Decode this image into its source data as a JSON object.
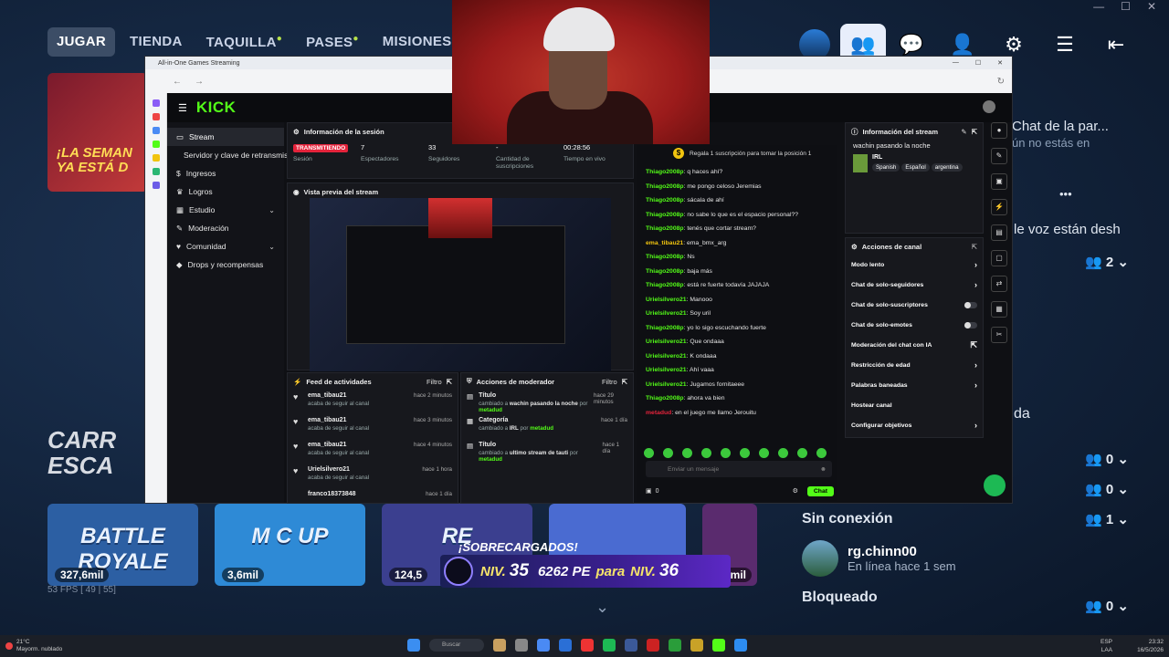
{
  "game": {
    "nav": [
      "JUGAR",
      "TIENDA",
      "TAQUILLA",
      "PASES",
      "MISIONES",
      "C"
    ],
    "promo_text": "¡LA SEMAN YA ESTÁ D",
    "carr_text": "CARR ESCA",
    "right_panel": {
      "party_title": "Chat de la par...",
      "party_sub": "ún no estás en",
      "voice_text": "le voz están desh",
      "da_text": "da",
      "counts": [
        "2",
        "0",
        "0",
        "1",
        "0"
      ],
      "offline_title": "Sin conexión",
      "friend_name": "rg.chinn00",
      "friend_status": "En línea hace 1 sem",
      "blocked_title": "Bloqueado",
      "ellipsis": "•••"
    },
    "tiles": [
      {
        "title": "BATTLE ROYALE",
        "count": "327,6mil",
        "color": "#2c5fa3"
      },
      {
        "title": "M C UP",
        "count": "3,6mil",
        "color": "#2e8ad6"
      },
      {
        "title": "RE",
        "count": "124,5",
        "color": "#3b3f8f"
      },
      {
        "title": "",
        "count": "",
        "color": "#4a6bd1"
      },
      {
        "title": "",
        "count": "1,9mil",
        "color": "#5a2b6e"
      }
    ],
    "level": {
      "overcharged": "¡SOBRECARGADOS!",
      "niv_label": "NIV.",
      "niv": "35",
      "pe": "6262 PE",
      "para": "para",
      "next_label": "NIV.",
      "next": "36"
    },
    "fps": "53 FPS [ 49 | 55]"
  },
  "window": {
    "title": "All-in-One Games Streaming",
    "kick_logo": "KICK",
    "sidebar": [
      {
        "label": "Stream",
        "icon": "stream-icon"
      },
      {
        "label": "Servidor y clave de retransmisión",
        "icon": ""
      },
      {
        "label": "Ingresos",
        "icon": "money-icon"
      },
      {
        "label": "Logros",
        "icon": "trophy-icon"
      },
      {
        "label": "Estudio",
        "icon": "studio-icon"
      },
      {
        "label": "Moderación",
        "icon": "mod-icon"
      },
      {
        "label": "Comunidad",
        "icon": "community-icon"
      },
      {
        "label": "Drops y recompensas",
        "icon": "gift-icon"
      }
    ],
    "session": {
      "title": "Información de la sesión",
      "live_badge": "TRANSMITIENDO",
      "session_label": "Sesión",
      "stats": [
        {
          "value": "7",
          "label": "Espectadores"
        },
        {
          "value": "33",
          "label": "Seguidores"
        },
        {
          "value": "-",
          "label": "Cantidad de suscripciones"
        },
        {
          "value": "00:28:56",
          "label": "Tiempo en vivo"
        }
      ]
    },
    "preview_title": "Vista previa del stream",
    "feed": {
      "title": "Feed de actividades",
      "filter": "Filtro",
      "rows": [
        {
          "name": "ema_tibau21",
          "sub": "acaba de seguir al canal",
          "time": "hace 2 minutos"
        },
        {
          "name": "ema_tibau21",
          "sub": "acaba de seguir al canal",
          "time": "hace 3 minutos"
        },
        {
          "name": "ema_tibau21",
          "sub": "acaba de seguir al canal",
          "time": "hace 4 minutos"
        },
        {
          "name": "Urielsilvero21",
          "sub": "acaba de seguir al canal",
          "time": "hace 1 hora"
        },
        {
          "name": "franco18373848",
          "sub": "",
          "time": "hace 1 día"
        }
      ]
    },
    "mod_actions": {
      "title": "Acciones de moderador",
      "filter": "Filtro",
      "rows": [
        {
          "name": "Título",
          "pre": "cambiado a",
          "val": "wachin pasando la noche",
          "by": "por",
          "user": "metadud",
          "time": "hace 29 minutos"
        },
        {
          "name": "Categoría",
          "pre": "cambiado a",
          "val": "IRL",
          "by": "por",
          "user": "metadud",
          "time": "hace 1 día"
        },
        {
          "name": "Título",
          "pre": "cambiado a",
          "val": "ultimo stream de tauti",
          "by": "por",
          "user": "metadud",
          "time": "hace 1 día"
        }
      ]
    },
    "chat": {
      "pinned": "Regala 1 suscripción para tomar la posición 1",
      "messages": [
        {
          "user": "Thiago2008p",
          "text": "q haces ahí?",
          "color": "#53fc18"
        },
        {
          "user": "Thiago2008p",
          "text": "me pongo celoso Jeremias",
          "color": "#53fc18"
        },
        {
          "user": "Thiago2008p",
          "text": "sácala de ahí",
          "color": "#53fc18"
        },
        {
          "user": "Thiago2008p",
          "text": "no sabe lo que es el espacio personal??",
          "color": "#53fc18"
        },
        {
          "user": "Thiago2008p",
          "text": "tenés que cortar stream?",
          "color": "#53fc18"
        },
        {
          "user": "ema_tibau21",
          "text": "ema_bmx_arg",
          "color": "#f1c40f"
        },
        {
          "user": "Thiago2008p",
          "text": "Ns",
          "color": "#53fc18"
        },
        {
          "user": "Thiago2008p",
          "text": "baja más",
          "color": "#53fc18"
        },
        {
          "user": "Thiago2008p",
          "text": "está re fuerte todavía JAJAJA",
          "color": "#53fc18"
        },
        {
          "user": "Urielsilvero21",
          "text": "Manooo",
          "color": "#53fc18"
        },
        {
          "user": "Urielsilvero21",
          "text": "Soy uril",
          "color": "#53fc18"
        },
        {
          "user": "Thiago2008p",
          "text": "yo lo sigo escuchando fuerte",
          "color": "#53fc18"
        },
        {
          "user": "Urielsilvero21",
          "text": "Que ondaaa",
          "color": "#53fc18"
        },
        {
          "user": "Urielsilvero21",
          "text": "K ondaaa",
          "color": "#53fc18"
        },
        {
          "user": "Urielsilvero21",
          "text": "Ahí vaaa",
          "color": "#53fc18"
        },
        {
          "user": "Urielsilvero21",
          "text": "Jugamos fornitaeee",
          "color": "#53fc18"
        },
        {
          "user": "Thiago2008p",
          "text": "ahora va bien",
          "color": "#53fc18"
        },
        {
          "user": "metadud",
          "text": "en el juego me llamo Jerouitu",
          "color": "#e4233b"
        }
      ],
      "placeholder": "Enviar un mensaje",
      "points": "0",
      "send": "Chat"
    },
    "stream_info": {
      "title": "Información del stream",
      "stream_title": "wachin pasando la noche",
      "category": "IRL",
      "tags": [
        "Spanish",
        "Español",
        "argentina"
      ]
    },
    "channel_actions": {
      "title": "Acciones de canal",
      "items": [
        {
          "label": "Modo lento",
          "type": "arrow"
        },
        {
          "label": "Chat de solo-seguidores",
          "type": "arrow"
        },
        {
          "label": "Chat de solo-suscriptores",
          "type": "toggle"
        },
        {
          "label": "Chat de solo-emotes",
          "type": "toggle"
        },
        {
          "label": "Moderación del chat con IA",
          "type": "link"
        },
        {
          "label": "Restricción de edad",
          "type": "arrow"
        },
        {
          "label": "Palabras baneadas",
          "type": "arrow"
        },
        {
          "label": "Hostear canal",
          "type": "none"
        },
        {
          "label": "Configurar objetivos",
          "type": "arrow"
        }
      ]
    }
  },
  "taskbar": {
    "weather_temp": "21°C",
    "weather_desc": "Mayorm. nublado",
    "search": "Buscar",
    "lang1": "ESP",
    "lang2": "LAA",
    "time": "23:32",
    "date": "16/5/2026"
  }
}
